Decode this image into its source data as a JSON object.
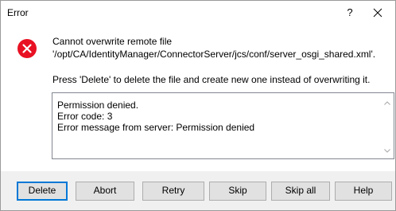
{
  "window": {
    "title": "Error",
    "help_glyph": "?",
    "close_glyph": "✕"
  },
  "icon": "error-icon",
  "colors": {
    "error_red": "#e81123",
    "accent": "#0078d7"
  },
  "message": {
    "line1": "Cannot overwrite remote file",
    "line2": "'/opt/CA/IdentityManager/ConnectorServer/jcs/conf/server_osgi_shared.xml'.",
    "line3": "Press 'Delete' to delete the file and create new one instead of overwriting it."
  },
  "details": {
    "lines": [
      "Permission denied.",
      "Error code: 3",
      "Error message from server: Permission denied"
    ]
  },
  "buttons": {
    "delete": "Delete",
    "abort": "Abort",
    "retry": "Retry",
    "skip": "Skip",
    "skip_all": "Skip all",
    "help": "Help"
  }
}
